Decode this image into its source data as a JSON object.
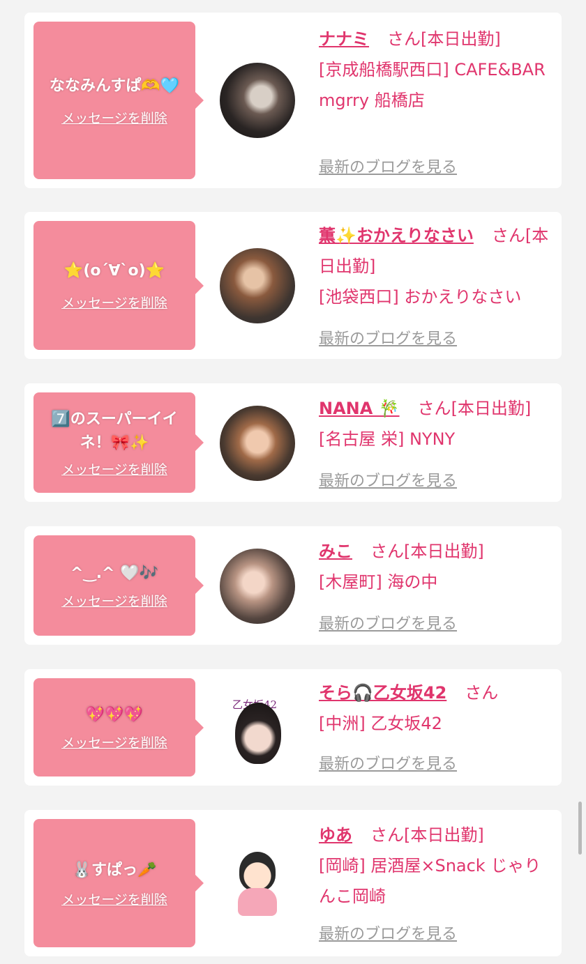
{
  "items": [
    {
      "message": "ななみんすぱ🫶🩵",
      "delete_label": "メッセージを削除",
      "name": "ナナミ",
      "san": "さん",
      "status": "[本日出勤]",
      "location": "[京成船橋駅西口] CAFE&BAR mgrry 船橋店",
      "blog_label": "最新のブログを見る"
    },
    {
      "message": "⭐️(o´∀`o)⭐️",
      "delete_label": "メッセージを削除",
      "name": "薫✨おかえりなさい",
      "san": "さん",
      "status": "[本日出勤]",
      "location": "[池袋西口] おかえりなさい",
      "blog_label": "最新のブログを見る"
    },
    {
      "message": "7️⃣のスーパーイイネ！🎀✨",
      "delete_label": "メッセージを削除",
      "name": "NANA 🎋",
      "san": "さん",
      "status": "[本日出勤]",
      "location": "[名古屋 栄] NYNY",
      "blog_label": "最新のブログを見る"
    },
    {
      "message": "^‿.^ 🤍🎶",
      "delete_label": "メッセージを削除",
      "name": "みこ",
      "san": "さん",
      "status": "[本日出勤]",
      "location": "[木屋町] 海の中",
      "blog_label": "最新のブログを見る"
    },
    {
      "message": "💖💖💖",
      "delete_label": "メッセージを削除",
      "name": "そら🎧乙女坂42",
      "san": "さん",
      "status": "",
      "location": "[中洲] 乙女坂42",
      "blog_label": "最新のブログを見る",
      "avatar_text": "乙女坂42"
    },
    {
      "message": "🐰すぱっ🥕",
      "delete_label": "メッセージを削除",
      "name": "ゆあ",
      "san": "さん",
      "status": "[本日出勤]",
      "location": "[岡崎] 居酒屋×Snack じゃりんこ岡崎",
      "blog_label": "最新のブログを見る"
    }
  ],
  "colors": {
    "accent": "#e0356d",
    "bubble": "#f48c9c",
    "background": "#f3f3f3",
    "link_gray": "#9a9a9a"
  }
}
